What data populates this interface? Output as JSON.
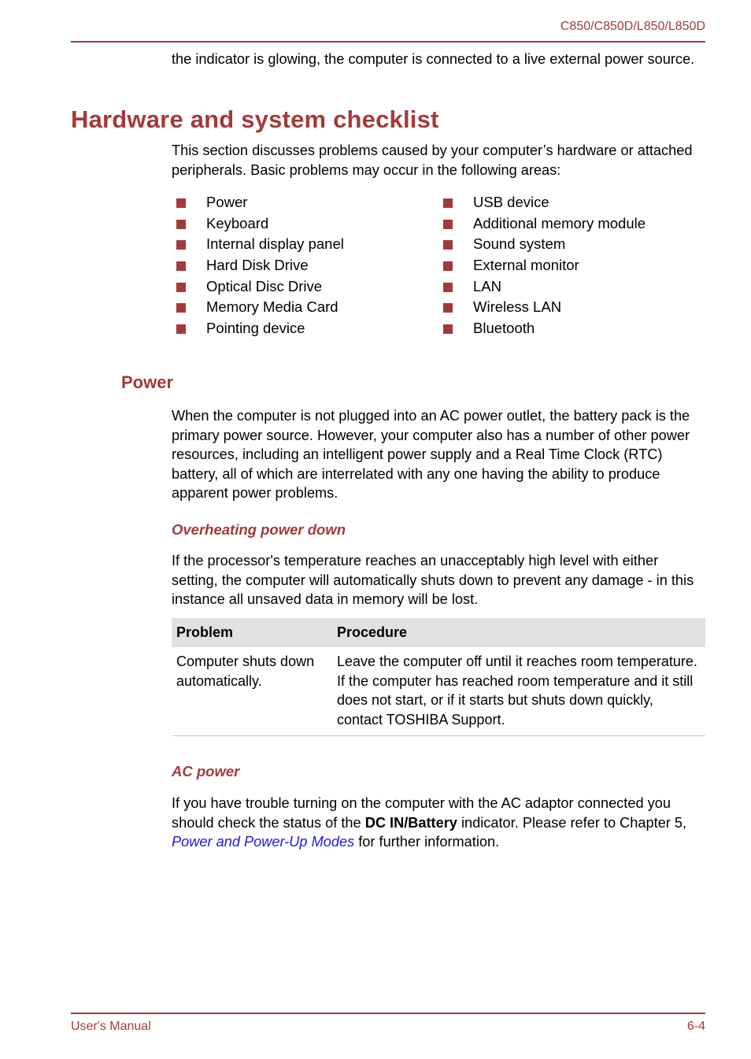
{
  "header": {
    "model": "C850/C850D/L850/L850D"
  },
  "intro_continuation": "the indicator is glowing, the computer is connected to a live external power source.",
  "section": {
    "title": "Hardware and system checklist",
    "intro": "This section discusses problems caused by your computer’s hardware or attached peripherals. Basic problems may occur in the following areas:",
    "areas_left": [
      "Power",
      "Keyboard",
      "Internal display panel",
      "Hard Disk Drive",
      "Optical Disc Drive",
      "Memory Media Card",
      "Pointing device"
    ],
    "areas_right": [
      "USB device",
      "Additional memory module",
      "Sound system",
      "External monitor",
      "LAN",
      "Wireless LAN",
      "Bluetooth"
    ]
  },
  "power": {
    "title": "Power",
    "text": "When the computer is not plugged into an AC power outlet, the battery pack is the primary power source. However, your computer also has a number of other power resources, including an intelligent power supply and a Real Time Clock (RTC) battery, all of which are interrelated with any one having the ability to produce apparent power problems.",
    "overheating": {
      "title": "Overheating power down",
      "text": "If the processor's temperature reaches an unacceptably high level with either setting, the computer will automatically shuts down to prevent any damage - in this instance all unsaved data in memory will be lost.",
      "table": {
        "headers": [
          "Problem",
          "Procedure"
        ],
        "rows": [
          {
            "problem": "Computer shuts down automatically.",
            "procedure": "Leave the computer off until it reaches room temperature. If the computer has reached room temperature and it still does not start, or if it starts but shuts down quickly, contact TOSHIBA Support."
          }
        ]
      }
    },
    "ac_power": {
      "title": "AC power",
      "text_before_bold": "If you have trouble turning on the computer with the AC adaptor connected you should check the status of the ",
      "bold": "DC IN/Battery",
      "text_after_bold": " indicator. Please refer to Chapter 5, ",
      "link": "Power and Power-Up Modes",
      "text_end": " for further information."
    }
  },
  "footer": {
    "left": "User's Manual",
    "right": "6-4"
  },
  "colors": {
    "accent": "#a33a3a",
    "link": "#1a1ae6",
    "table_header_bg": "#e1e1e1"
  }
}
